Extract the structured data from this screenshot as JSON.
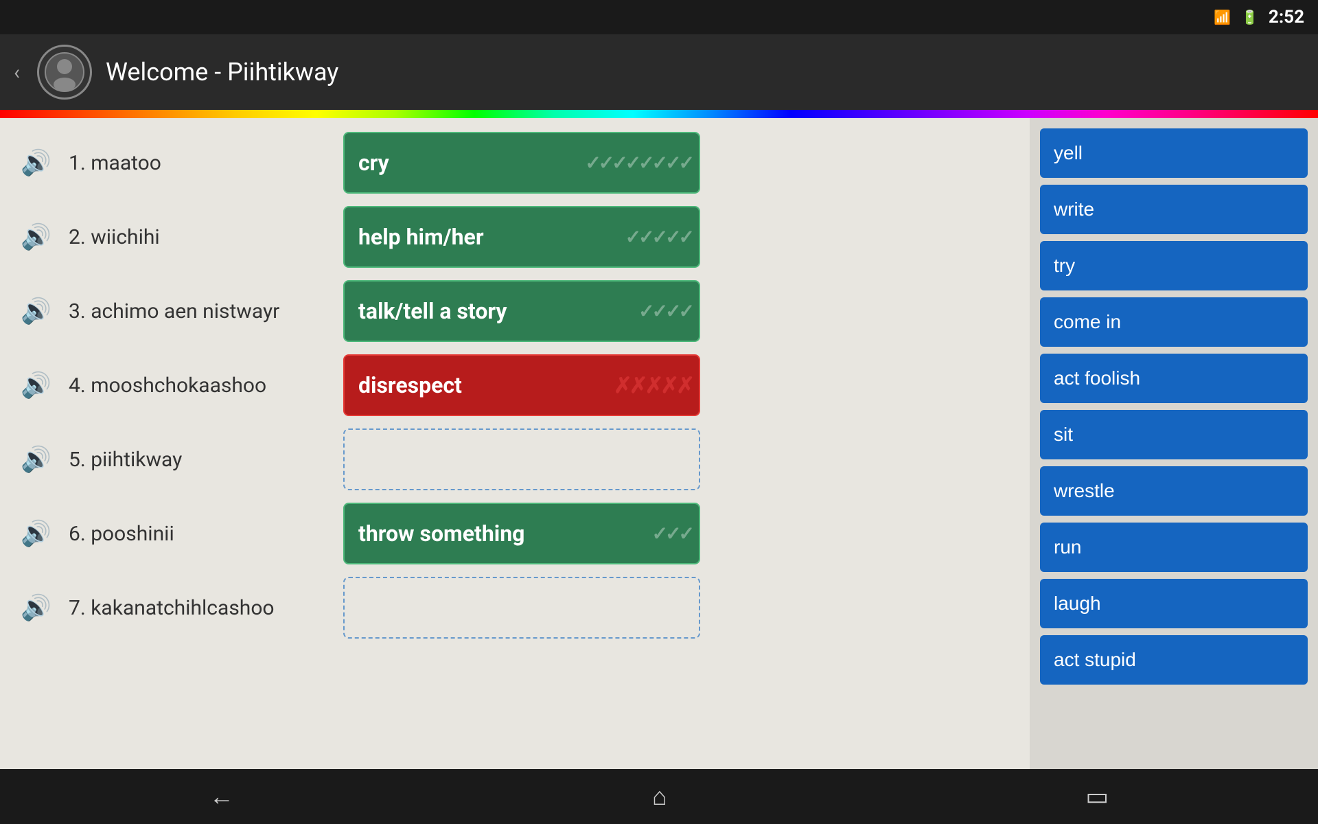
{
  "statusBar": {
    "time": "2:52",
    "wifiIcon": "📶",
    "batteryIcon": "🔋"
  },
  "header": {
    "title": "Welcome - Piihtikway",
    "backLabel": "‹"
  },
  "words": [
    {
      "number": "1.",
      "word": "maatoo",
      "answer": "cry",
      "status": "correct",
      "marks": "✓✓✓✓✓✓✓✓"
    },
    {
      "number": "2.",
      "word": "wiichihi",
      "answer": "help him/her",
      "status": "correct",
      "marks": "✓✓✓✓✓"
    },
    {
      "number": "3.",
      "word": "achimo aen nistwayr",
      "answer": "talk/tell a story",
      "status": "correct",
      "marks": "✓✓✓✓"
    },
    {
      "number": "4.",
      "word": "mooshchokaashoo",
      "answer": "disrespect",
      "status": "wrong",
      "marks": "✗✗✗✗✗"
    },
    {
      "number": "5.",
      "word": "piihtikway",
      "answer": "",
      "status": "empty",
      "marks": ""
    },
    {
      "number": "6.",
      "word": "pooshinii",
      "answer": "throw something",
      "status": "correct",
      "marks": "✓✓✓"
    },
    {
      "number": "7.",
      "word": "kakanatchihlcashoo",
      "answer": "",
      "status": "empty",
      "marks": ""
    }
  ],
  "choices": [
    "yell",
    "write",
    "try",
    "come in",
    "act foolish",
    "sit",
    "wrestle",
    "run",
    "laugh",
    "act stupid"
  ],
  "navBar": {
    "backSymbol": "←",
    "homeSymbol": "⌂",
    "recentSymbol": "▭"
  }
}
